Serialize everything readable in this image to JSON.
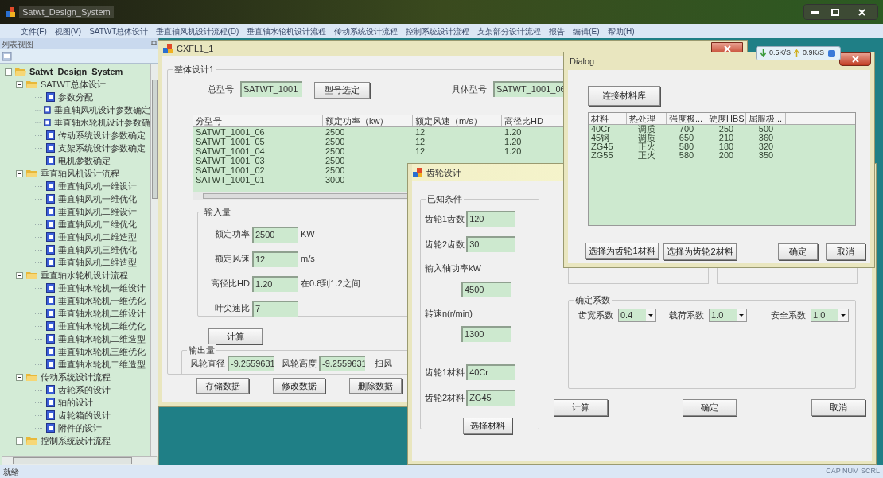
{
  "main_window": {
    "title": "Satwt_Design_System"
  },
  "menu_bar": [
    "文件(F)",
    "视图(V)",
    "SATWT总体设计",
    "垂直轴风机设计流程(D)",
    "垂直轴水轮机设计流程",
    "传动系统设计流程",
    "控制系统设计流程",
    "支架部分设计流程",
    "报告",
    "编辑(E)",
    "帮助(H)"
  ],
  "sidebar": {
    "title": "列表视图",
    "tree": [
      {
        "label": "Satwt_Design_System",
        "expanded": true,
        "children": [
          {
            "label": "SATWT总体设计",
            "expanded": true,
            "children": [
              {
                "label": "参数分配"
              },
              {
                "label": "垂直轴风机设计参数确定"
              },
              {
                "label": "垂直轴水轮机设计参数确"
              },
              {
                "label": "传动系统设计参数确定"
              },
              {
                "label": "支架系统设计参数确定"
              },
              {
                "label": "电机参数确定"
              }
            ]
          },
          {
            "label": "垂直轴风机设计流程",
            "expanded": true,
            "children": [
              {
                "label": "垂直轴风机一维设计"
              },
              {
                "label": "垂直轴风机一维优化"
              },
              {
                "label": "垂直轴风机二维设计"
              },
              {
                "label": "垂直轴风机二维优化"
              },
              {
                "label": "垂直轴风机二维造型"
              },
              {
                "label": "垂直轴风机三维优化"
              },
              {
                "label": "垂直轴风机二维造型"
              }
            ]
          },
          {
            "label": "垂直轴水轮机设计流程",
            "expanded": true,
            "children": [
              {
                "label": "垂直轴水轮机一维设计"
              },
              {
                "label": "垂直轴水轮机一维优化"
              },
              {
                "label": "垂直轴水轮机二维设计"
              },
              {
                "label": "垂直轴水轮机二维优化"
              },
              {
                "label": "垂直轴水轮机二维造型"
              },
              {
                "label": "垂直轴水轮机三维优化"
              },
              {
                "label": "垂直轴水轮机二维造型"
              }
            ]
          },
          {
            "label": "传动系统设计流程",
            "expanded": true,
            "children": [
              {
                "label": "齿轮系的设计"
              },
              {
                "label": "轴的设计"
              },
              {
                "label": "齿轮箱的设计"
              },
              {
                "label": "附件的设计"
              }
            ]
          },
          {
            "label": "控制系统设计流程",
            "expanded": true
          }
        ]
      }
    ]
  },
  "status_bar": {
    "text": "就绪",
    "indicators": "CAP NUM SCRL"
  },
  "network_widget": {
    "download": "0.5K/S",
    "upload": "0.9K/S"
  },
  "cxfl_window": {
    "title": "CXFL1_1",
    "group_title": "整体设计1",
    "model_label": "总型号",
    "model_value": "SATWT_1001",
    "select_button": "型号选定",
    "submodel_label": "具体型号",
    "submodel_value": "SATWT_1001_06",
    "table": {
      "columns": [
        "分型号",
        "额定功率（kw）",
        "额定风速（m/s）",
        "高径比HD"
      ],
      "rows": [
        [
          "SATWT_1001_06",
          "2500",
          "12",
          "1.20"
        ],
        [
          "SATWT_1001_05",
          "2500",
          "12",
          "1.20"
        ],
        [
          "SATWT_1001_04",
          "2500",
          "12",
          "1.20"
        ],
        [
          "SATWT_1001_03",
          "2500"
        ],
        [
          "SATWT_1001_02",
          "2500"
        ],
        [
          "SATWT_1001_01",
          "3000"
        ]
      ]
    },
    "input_group": {
      "title": "输入量",
      "fields": [
        {
          "label": "额定功率",
          "value": "2500",
          "unit": "KW"
        },
        {
          "label": "额定风速",
          "value": "12",
          "unit": "m/s"
        },
        {
          "label": "高径比HD",
          "value": "1.20",
          "unit": "在0.8到1.2之间"
        },
        {
          "label": "叶尖速比",
          "value": "7"
        }
      ]
    },
    "calc_button": "计算",
    "output_group": {
      "title": "输出量",
      "fields": [
        {
          "label": "风轮直径",
          "value": "-9.2559631"
        },
        {
          "label": "风轮高度",
          "value": "-9.2559631"
        }
      ],
      "cut_label": "扫风"
    },
    "buttons": [
      "存储数据",
      "修改数据",
      "删除数据"
    ]
  },
  "gear_window": {
    "title": "齿轮设计",
    "known_group": {
      "title": "已知条件",
      "fields": [
        {
          "kind": "inline",
          "label": "齿轮1齿数",
          "value": "120"
        },
        {
          "kind": "inline",
          "label": "齿轮2齿数",
          "value": "30"
        },
        {
          "kind": "stacked",
          "label": "输入轴功率kW",
          "value": "4500"
        },
        {
          "kind": "stacked",
          "label": "转速n(r/min)",
          "value": "1300"
        },
        {
          "kind": "inline",
          "label": "齿轮1材料",
          "value": "40Cr"
        },
        {
          "kind": "inline",
          "label": "齿轮2材料",
          "value": "ZG45"
        }
      ]
    },
    "select_material_button": "选择材料",
    "coef_group": {
      "title": "确定系数",
      "fields": [
        {
          "label": "齿宽系数",
          "value": "0.4"
        },
        {
          "label": "载荷系数",
          "value": "1.0"
        },
        {
          "label": "安全系数",
          "value": "1.0"
        }
      ]
    },
    "buttons": [
      "计算",
      "确定",
      "取消"
    ]
  },
  "dialog": {
    "title": "Dialog",
    "connect_button": "连接材料库",
    "table": {
      "columns": [
        "材料",
        "热处理",
        "强度极...",
        "硬度HBS",
        "屈服极..."
      ],
      "rows": [
        [
          "40Cr",
          "调质",
          "700",
          "250",
          "500"
        ],
        [
          "45钢",
          "调质",
          "650",
          "210",
          "360"
        ],
        [
          "ZG45",
          "正火",
          "580",
          "180",
          "320"
        ],
        [
          "ZG55",
          "正火",
          "580",
          "200",
          "350"
        ]
      ]
    },
    "buttons": [
      "选择为齿轮1材料",
      "选择为齿轮2材料",
      "确定",
      "取消"
    ]
  }
}
